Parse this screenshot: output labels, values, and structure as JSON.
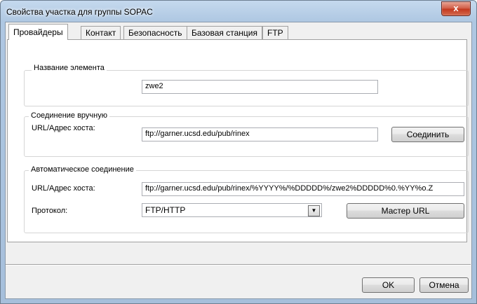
{
  "window": {
    "title": "Свойства участка для группы SOPAC",
    "close_glyph": "x"
  },
  "tabs": [
    {
      "label": "Провайдеры",
      "active": true
    },
    {
      "label": "Контакт",
      "active": false
    },
    {
      "label": "Безопасность",
      "active": false
    },
    {
      "label": "Базовая станция",
      "active": false
    },
    {
      "label": "FTP",
      "active": false
    }
  ],
  "element_name": {
    "group_label": "Название элемента",
    "value": "zwe2"
  },
  "manual": {
    "group_label": "Соединение вручную",
    "url_label": "URL/Адрес хоста:",
    "url_value": "ftp://garner.ucsd.edu/pub/rinex",
    "connect_label": "Соединить"
  },
  "auto": {
    "group_label": "Автоматическое соединение",
    "url_label": "URL/Адрес хоста:",
    "url_value": "ftp://garner.ucsd.edu/pub/rinex/%YYYY%/%DDDDD%/zwe2%DDDDD%0.%YY%o.Z",
    "protocol_label": "Протокол:",
    "protocol_value": "FTP/HTTP",
    "wizard_label": "Мастер URL"
  },
  "footer": {
    "ok_label": "OK",
    "cancel_label": "Отмена"
  }
}
